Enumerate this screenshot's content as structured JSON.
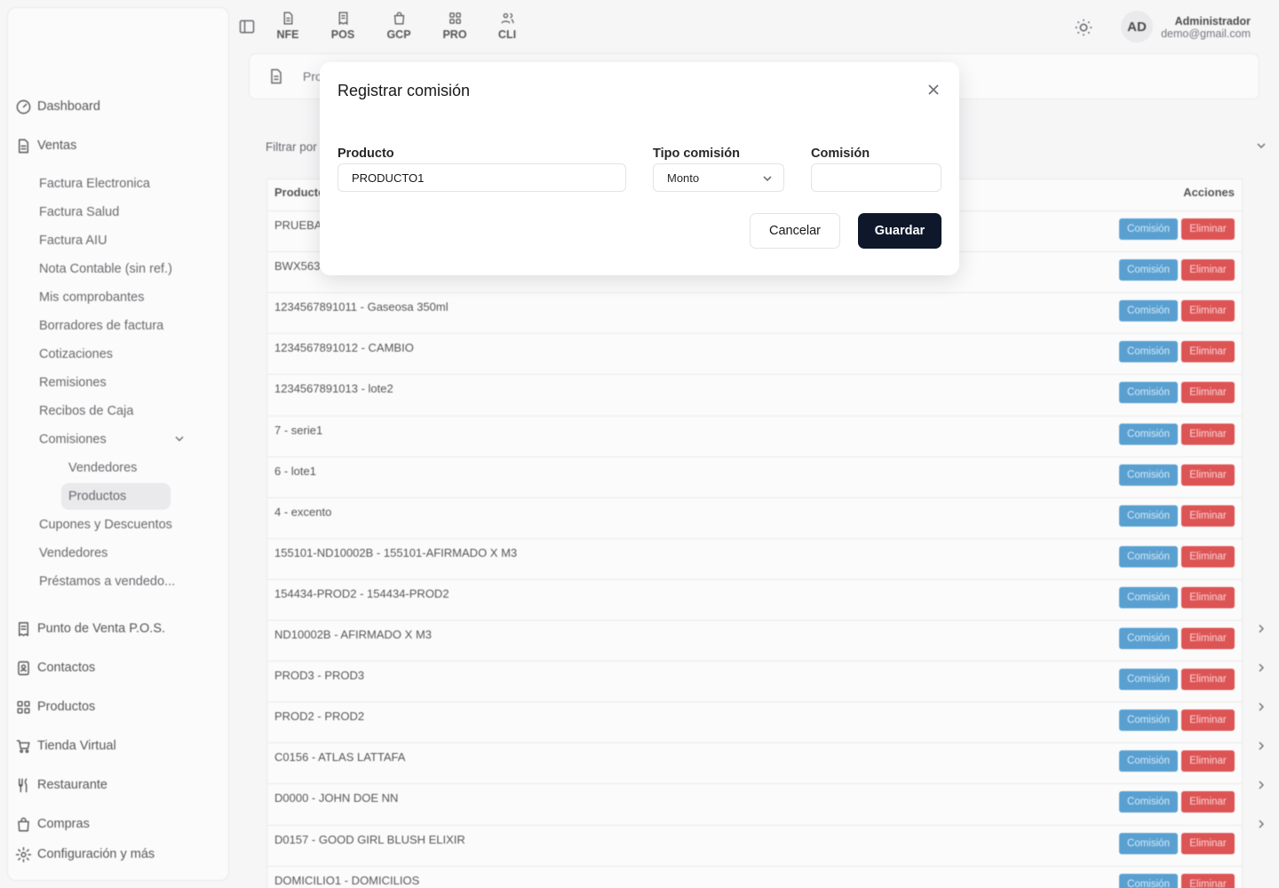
{
  "topbar": {
    "tabs": [
      {
        "label": "NFE",
        "icon": "file-icon"
      },
      {
        "label": "POS",
        "icon": "receipt-icon"
      },
      {
        "label": "GCP",
        "icon": "bag-icon"
      },
      {
        "label": "PRO",
        "icon": "grid-icon"
      },
      {
        "label": "CLI",
        "icon": "users-icon"
      }
    ],
    "user": {
      "initials": "AD",
      "name": "Administrador",
      "email": "demo@gmail.com"
    }
  },
  "sidebar": {
    "dashboard": "Dashboard",
    "ventas": "Ventas",
    "ventas_items": [
      "Factura Electronica",
      "Factura Salud",
      "Factura AIU",
      "Nota Contable (sin ref.)",
      "Mis comprobantes",
      "Borradores de factura",
      "Cotizaciones",
      "Remisiones",
      "Recibos de Caja"
    ],
    "comisiones": "Comisiones",
    "comisiones_items": [
      "Vendedores",
      "Productos"
    ],
    "ventas_items_after": [
      "Cupones y Descuentos",
      "Vendedores",
      "Préstamos a vendedo..."
    ],
    "sections": [
      "Punto de Venta P.O.S.",
      "Contactos",
      "Productos",
      "Tienda Virtual",
      "Restaurante",
      "Compras"
    ],
    "config": "Configuración y más"
  },
  "page": {
    "breadcrumb": "Pro",
    "filter_label": "Filtrar por",
    "table": {
      "col_product": "Producto",
      "col_actions": "Acciones",
      "btn_commission": "Comisión",
      "btn_delete": "Eliminar",
      "rows": [
        "PRUEBA",
        "BWX563",
        "1234567891011 - Gaseosa 350ml",
        "1234567891012 - CAMBIO",
        "1234567891013 - lote2",
        "7 - serie1",
        "6 - lote1",
        "4 - excento",
        "155101-ND10002B - 155101-AFIRMADO X M3",
        "154434-PROD2 - 154434-PROD2",
        "ND10002B - AFIRMADO X M3",
        "PROD3 - PROD3",
        "PROD2 - PROD2",
        "C0156 - ATLAS LATTAFA",
        "D0000 - JOHN DOE NN",
        "D0157 - GOOD GIRL BLUSH ELIXIR",
        "DOMICILIO1 - DOMICILIOS"
      ]
    }
  },
  "modal": {
    "title": "Registrar comisión",
    "product_label": "Producto",
    "product_value": "PRODUCTO1",
    "type_label": "Tipo comisión",
    "type_value": "Monto",
    "commission_label": "Comisión",
    "commission_value": "",
    "cancel": "Cancelar",
    "save": "Guardar"
  }
}
